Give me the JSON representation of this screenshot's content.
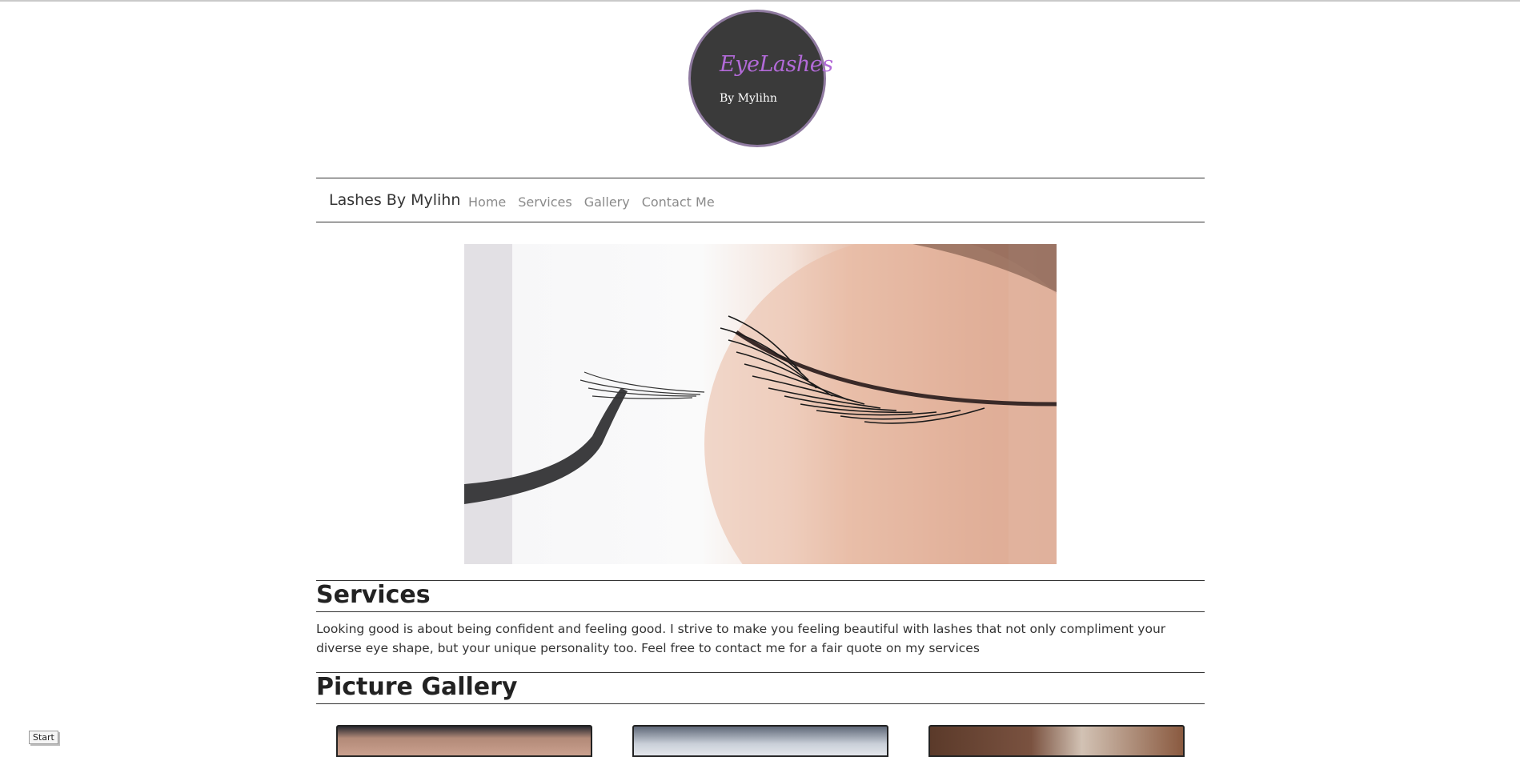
{
  "logo": {
    "title": "EyeLashes",
    "subtitle": "By Mylihn"
  },
  "navbar": {
    "brand": "Lashes By Mylihn",
    "links": [
      "Home",
      "Services",
      "Gallery",
      "Contact Me"
    ]
  },
  "hero": {
    "alt": "eyelash extension closeup with tweezers"
  },
  "services": {
    "heading": "Services",
    "text": "Looking good is about being confident and feeling good. I strive to make you feeling beautiful with lashes that not only compliment your diverse eye shape, but your unique personality too. Feel free to contact me for a fair quote on my services"
  },
  "gallery": {
    "heading": "Picture Gallery"
  },
  "start_button": "Start",
  "colors": {
    "accent": "#b26ad8",
    "logo_border": "#8f7aa0",
    "logo_bg": "#3a3a3a"
  }
}
